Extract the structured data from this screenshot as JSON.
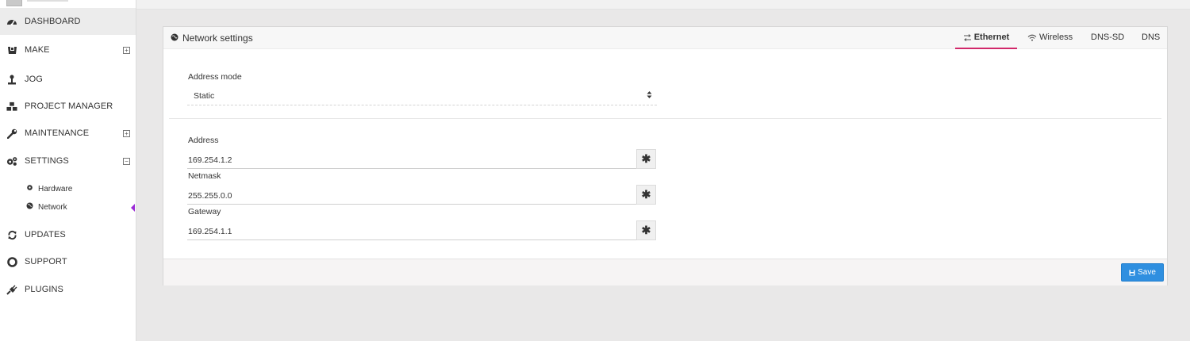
{
  "sidebar": {
    "items": [
      {
        "label": "DASHBOARD",
        "icon": "dashboard-icon"
      },
      {
        "label": "MAKE",
        "icon": "make-icon",
        "toggle": "plus"
      },
      {
        "label": "JOG",
        "icon": "jog-icon"
      },
      {
        "label": "PROJECT MANAGER",
        "icon": "cubes-icon"
      },
      {
        "label": "MAINTENANCE",
        "icon": "wrench-icon",
        "toggle": "plus"
      },
      {
        "label": "SETTINGS",
        "icon": "gears-icon",
        "toggle": "minus"
      },
      {
        "label": "UPDATES",
        "icon": "refresh-icon"
      },
      {
        "label": "SUPPORT",
        "icon": "life-ring-icon"
      },
      {
        "label": "PLUGINS",
        "icon": "plug-icon"
      }
    ],
    "settings_sub": [
      {
        "label": "Hardware",
        "icon": "cog-icon"
      },
      {
        "label": "Network",
        "icon": "globe-icon"
      }
    ]
  },
  "panel": {
    "title": "Network settings",
    "title_icon": "globe-icon",
    "tabs": [
      {
        "label": "Ethernet",
        "icon": "ethernet-icon",
        "active": true
      },
      {
        "label": "Wireless",
        "icon": "wifi-icon"
      },
      {
        "label": "DNS-SD"
      },
      {
        "label": "DNS"
      }
    ],
    "address_mode": {
      "label": "Address mode",
      "value": "Static"
    },
    "fields": [
      {
        "label": "Address",
        "value": "169.254.1.2"
      },
      {
        "label": "Netmask",
        "value": "255.255.0.0"
      },
      {
        "label": "Gateway",
        "value": "169.254.1.1"
      }
    ],
    "addon_symbol": "✱",
    "save_label": "Save"
  },
  "colors": {
    "accent_tab": "#d1286a",
    "save_button": "#2f8fe0",
    "active_indicator": "#9b2bd6"
  }
}
